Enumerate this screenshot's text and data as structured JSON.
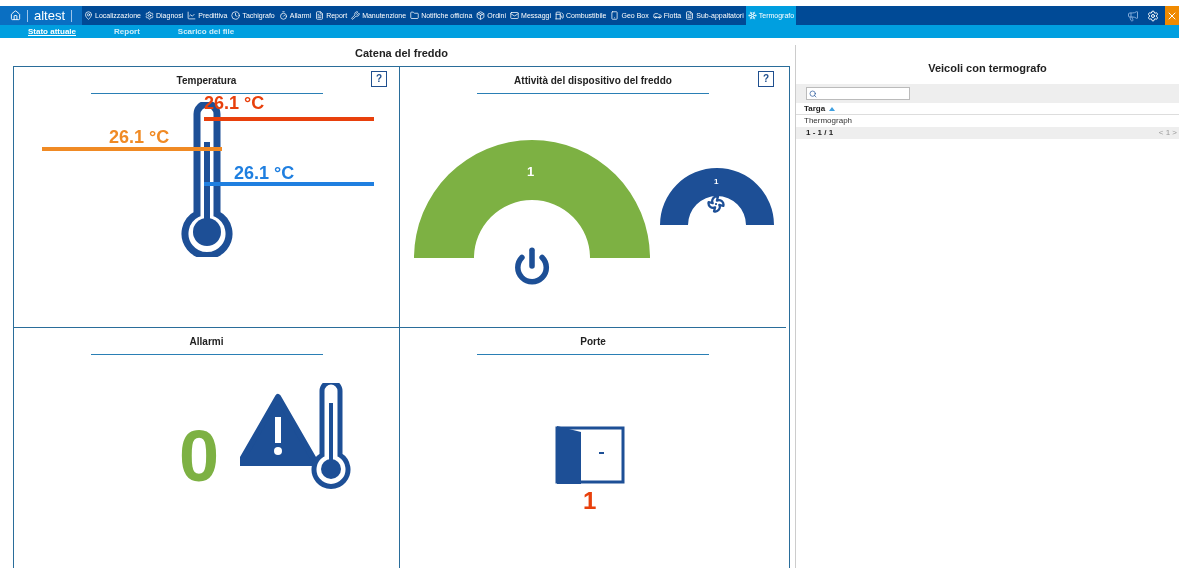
{
  "nav": {
    "logo": "altest",
    "items": [
      {
        "label": "Localizzazione",
        "selected": false
      },
      {
        "label": "Diagnosi",
        "selected": false
      },
      {
        "label": "Predittiva",
        "selected": false
      },
      {
        "label": "Tachigrafo",
        "selected": false
      },
      {
        "label": "Allarmi",
        "selected": false
      },
      {
        "label": "Report",
        "selected": false
      },
      {
        "label": "Manutenzione",
        "selected": false
      },
      {
        "label": "Notifiche officina",
        "selected": false
      },
      {
        "label": "Ordini",
        "selected": false
      },
      {
        "label": "Messaggi",
        "selected": false
      },
      {
        "label": "Combustibile",
        "selected": false
      },
      {
        "label": "Geo Box",
        "selected": false
      },
      {
        "label": "Flotta",
        "selected": false
      },
      {
        "label": "Sub-appaltatori",
        "selected": false
      },
      {
        "label": "Termografo",
        "selected": true
      }
    ]
  },
  "subnav": [
    {
      "label": "Stato attuale",
      "selected": true
    },
    {
      "label": "Report",
      "selected": false
    },
    {
      "label": "Scarico dei file",
      "selected": false
    }
  ],
  "page_title": "Catena del freddo",
  "temperatura": {
    "title": "Temperatura",
    "help": "?",
    "readings": [
      {
        "value": "26.1 °C",
        "color": "#e8400c"
      },
      {
        "value": "26.1 °C",
        "color": "#f08a24"
      },
      {
        "value": "26.1 °C",
        "color": "#1f7fe0"
      }
    ]
  },
  "attivita": {
    "title": "Attività del dispositivo del freddo",
    "help": "?",
    "power_value": "1",
    "fan_value": "1"
  },
  "allarmi": {
    "title": "Allarmi",
    "count": "0"
  },
  "porte": {
    "title": "Porte",
    "count": "1"
  },
  "veicoli": {
    "title": "Veicoli con termografo",
    "column": "Targa",
    "rows": [
      "Thermograph"
    ],
    "range": "1 - 1 / 1",
    "pager": "< 1 >"
  }
}
